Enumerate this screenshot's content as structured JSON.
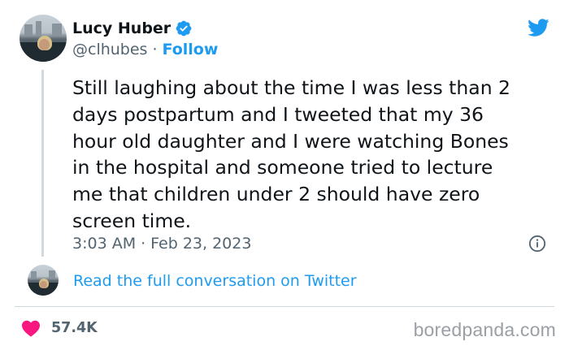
{
  "author": {
    "name": "Lucy Huber",
    "handle": "@clhubes",
    "separator": "·",
    "follow_label": "Follow"
  },
  "tweet": {
    "text": "Still laughing about the time I was less than 2\ndays postpartum and I tweeted that my 36\nhour old daughter and I were watching Bones\nin the hospital and someone tried to lecture\nme that children under 2 should have zero\nscreen time.",
    "time": "3:03 AM",
    "separator": "·",
    "date": "Feb 23, 2023"
  },
  "conversation": {
    "link_label": "Read the full conversation on Twitter"
  },
  "engagement": {
    "likes": "57.4K"
  },
  "watermark": "boredpanda.com",
  "icons": {
    "verified": "verified-badge-icon",
    "twitter": "twitter-bird-icon",
    "info": "info-icon",
    "like": "heart-icon"
  },
  "colors": {
    "accent_blue": "#1d9bf0",
    "text": "#0f1419",
    "secondary": "#536471",
    "like_pink": "#f91880",
    "divider": "#cfd9de"
  }
}
